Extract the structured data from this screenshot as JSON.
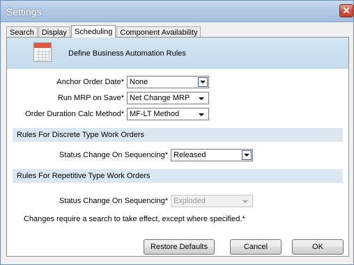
{
  "window": {
    "title": "Settings",
    "close_glyph": "✕"
  },
  "tabs": [
    {
      "label": "Search"
    },
    {
      "label": "Display"
    },
    {
      "label": "Scheduling"
    },
    {
      "label": "Component Availability"
    }
  ],
  "header": {
    "title": "Define Business Automation Rules",
    "icon": "calendar-icon"
  },
  "fields": {
    "anchor_order_date": {
      "label": "Anchor Order Date*",
      "value": "None"
    },
    "run_mrp_on_save": {
      "label": "Run MRP on Save*",
      "value": "Net Change MRP"
    },
    "order_duration_calc": {
      "label": "Order Duration Calc Method*",
      "value": "MF-LT Method"
    }
  },
  "discrete": {
    "section_title": "Rules For Discrete Type Work Orders",
    "status_label": "Status Change On Sequencing*",
    "status_value": "Released"
  },
  "repetitive": {
    "section_title": "Rules For Repetitive Type Work Orders",
    "status_label": "Status Change On Sequencing*",
    "status_value": "Exploded"
  },
  "note": "Changes require a search to take effect, except where specified.*",
  "buttons": {
    "restore_defaults": "Restore Defaults",
    "cancel": "Cancel",
    "ok": "OK"
  },
  "colors": {
    "header_band": "#d3e4f2",
    "section_band": "#dbe7f1",
    "close_button": "#cd4f3c"
  }
}
